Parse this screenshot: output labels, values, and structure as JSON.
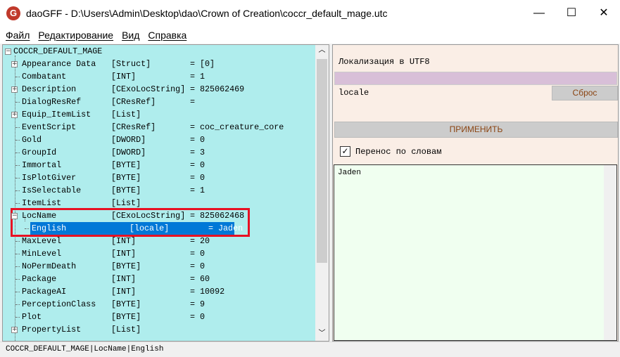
{
  "window": {
    "title": "daoGFF - D:\\Users\\Admin\\Desktop\\dao\\Crown of Creation\\coccr_default_mage.utc",
    "icon": "G",
    "minimize": "—",
    "maximize": "☐",
    "close": "✕"
  },
  "menu": [
    "Файл",
    "Редактирование",
    "Вид",
    "Справка"
  ],
  "tree": {
    "root": "COCCR_DEFAULT_MAGE",
    "rows": [
      {
        "name": "Appearance Data",
        "type": "[Struct]",
        "value": "= [0]",
        "exp": "+"
      },
      {
        "name": "Combatant",
        "type": "[INT]",
        "value": "= 1"
      },
      {
        "name": "Description",
        "type": "[CExoLocString]",
        "value": "= 825062469",
        "exp": "+"
      },
      {
        "name": "DialogResRef",
        "type": "[CResRef]",
        "value": "="
      },
      {
        "name": "Equip_ItemList",
        "type": "[List]",
        "value": "",
        "exp": "+"
      },
      {
        "name": "EventScript",
        "type": "[CResRef]",
        "value": "= coc_creature_core"
      },
      {
        "name": "Gold",
        "type": "[DWORD]",
        "value": "= 0"
      },
      {
        "name": "GroupId",
        "type": "[DWORD]",
        "value": "= 3"
      },
      {
        "name": "Immortal",
        "type": "[BYTE]",
        "value": "= 0"
      },
      {
        "name": "IsPlotGiver",
        "type": "[BYTE]",
        "value": "= 0"
      },
      {
        "name": "IsSelectable",
        "type": "[BYTE]",
        "value": "= 1"
      },
      {
        "name": "ItemList",
        "type": "[List]",
        "value": ""
      },
      {
        "name": "LocName",
        "type": "[CExoLocString]",
        "value": "= 825062468",
        "exp": "−"
      },
      {
        "name": "English",
        "type": "[locale]",
        "value": "= Jaden",
        "child": true,
        "selected": true
      },
      {
        "name": "MaxLevel",
        "type": "[INT]",
        "value": "= 20"
      },
      {
        "name": "MinLevel",
        "type": "[INT]",
        "value": "= 0"
      },
      {
        "name": "NoPermDeath",
        "type": "[BYTE]",
        "value": "= 0"
      },
      {
        "name": "Package",
        "type": "[INT]",
        "value": "= 60"
      },
      {
        "name": "PackageAI",
        "type": "[INT]",
        "value": "= 10092"
      },
      {
        "name": "PerceptionClass",
        "type": "[BYTE]",
        "value": "= 9"
      },
      {
        "name": "Plot",
        "type": "[BYTE]",
        "value": "= 0"
      },
      {
        "name": "PropertyList",
        "type": "[List]",
        "value": "",
        "exp": "+"
      }
    ]
  },
  "status": "COCCR_DEFAULT_MAGE|LocName|English",
  "panel": {
    "heading": "Локализация в UTF8",
    "locale_label": "locale",
    "reset": "Сброс",
    "apply": "ПРИМЕНИТЬ",
    "wrap_label": "Перенос по словам",
    "wrap_checked": true,
    "text": "Jaden"
  }
}
